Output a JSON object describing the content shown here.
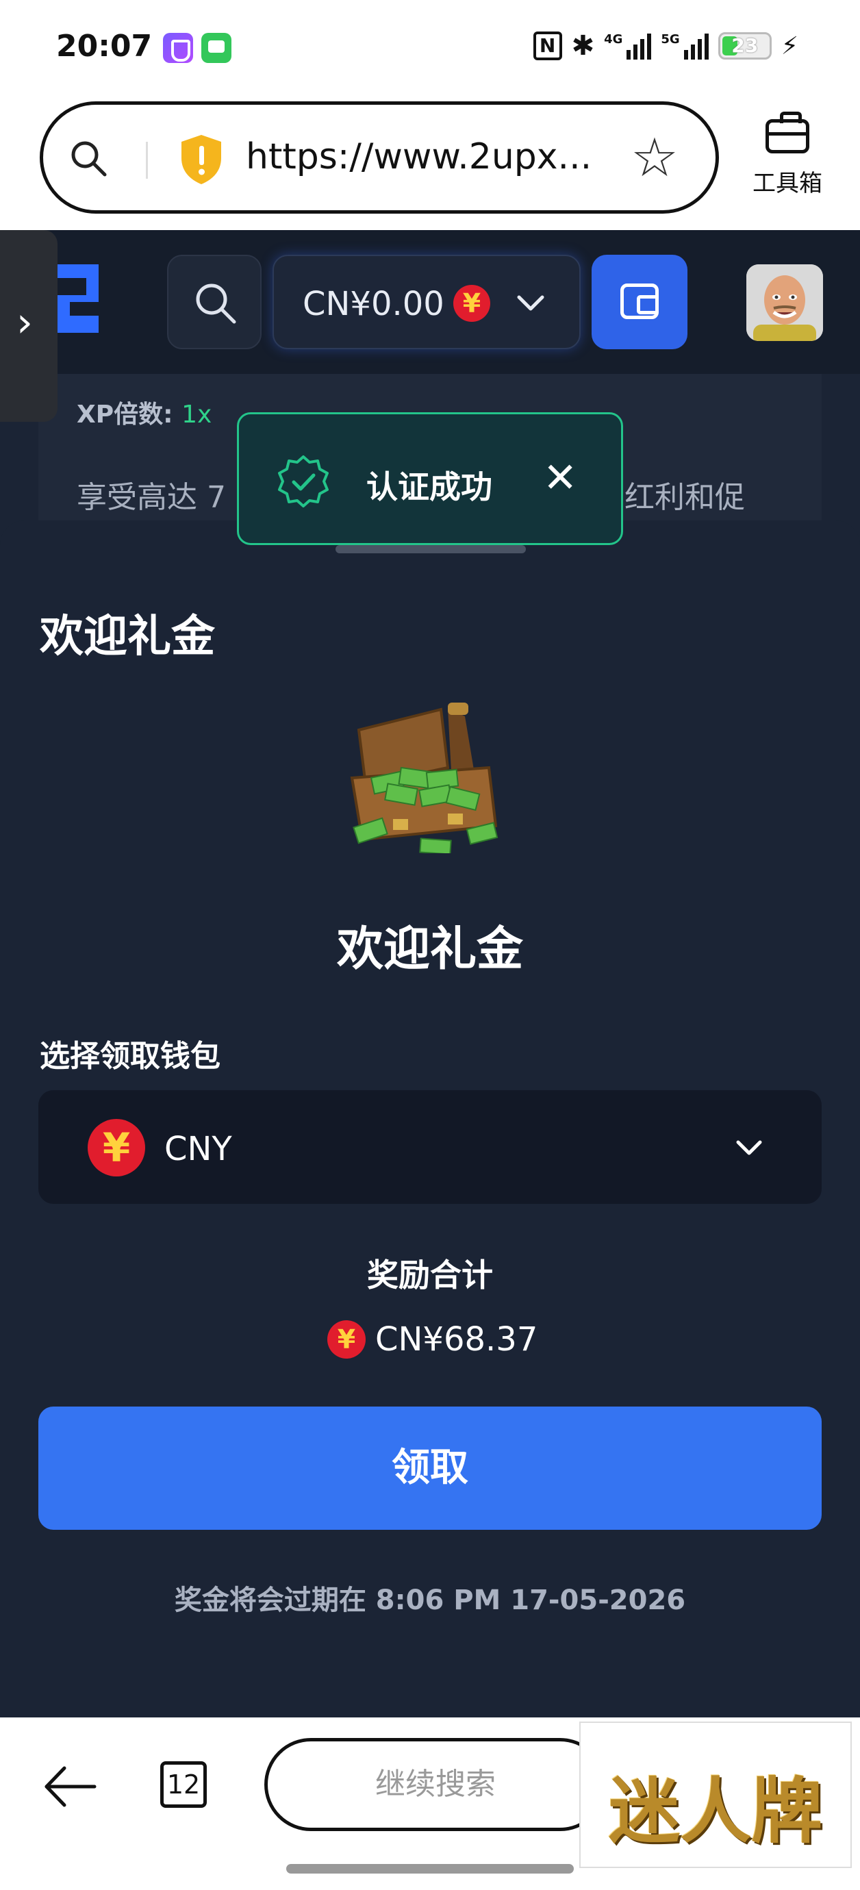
{
  "status_bar": {
    "time": "20:07",
    "nfc_label": "N",
    "net1": "4G",
    "net2": "5G",
    "battery": "23"
  },
  "browser": {
    "url": "https://www.2upx...",
    "toolbox_label": "工具箱",
    "tab_count": "12",
    "search_placeholder": "继续搜索"
  },
  "header": {
    "balance": "CN¥0.00",
    "currency_symbol": "¥",
    "side_arrow": "›"
  },
  "xp": {
    "label": "XP倍数:",
    "value": "1x",
    "promo_left": "享受高达 7",
    "promo_right": "红利和促"
  },
  "toast": {
    "message": "认证成功",
    "close": "✕"
  },
  "sheet": {
    "title": "欢迎礼金",
    "bonus_title": "欢迎礼金",
    "wallet_label": "选择领取钱包",
    "wallet_currency": "CNY",
    "reward_label": "奖励合计",
    "reward_amount": "CN¥68.37",
    "claim_button": "领取",
    "expiry": "奖金将会过期在 8:06 PM 17-05-2026"
  },
  "ad": {
    "text": "迷人牌"
  },
  "colors": {
    "accent": "#3574f2",
    "success": "#23c48a",
    "background": "#1b2435"
  }
}
